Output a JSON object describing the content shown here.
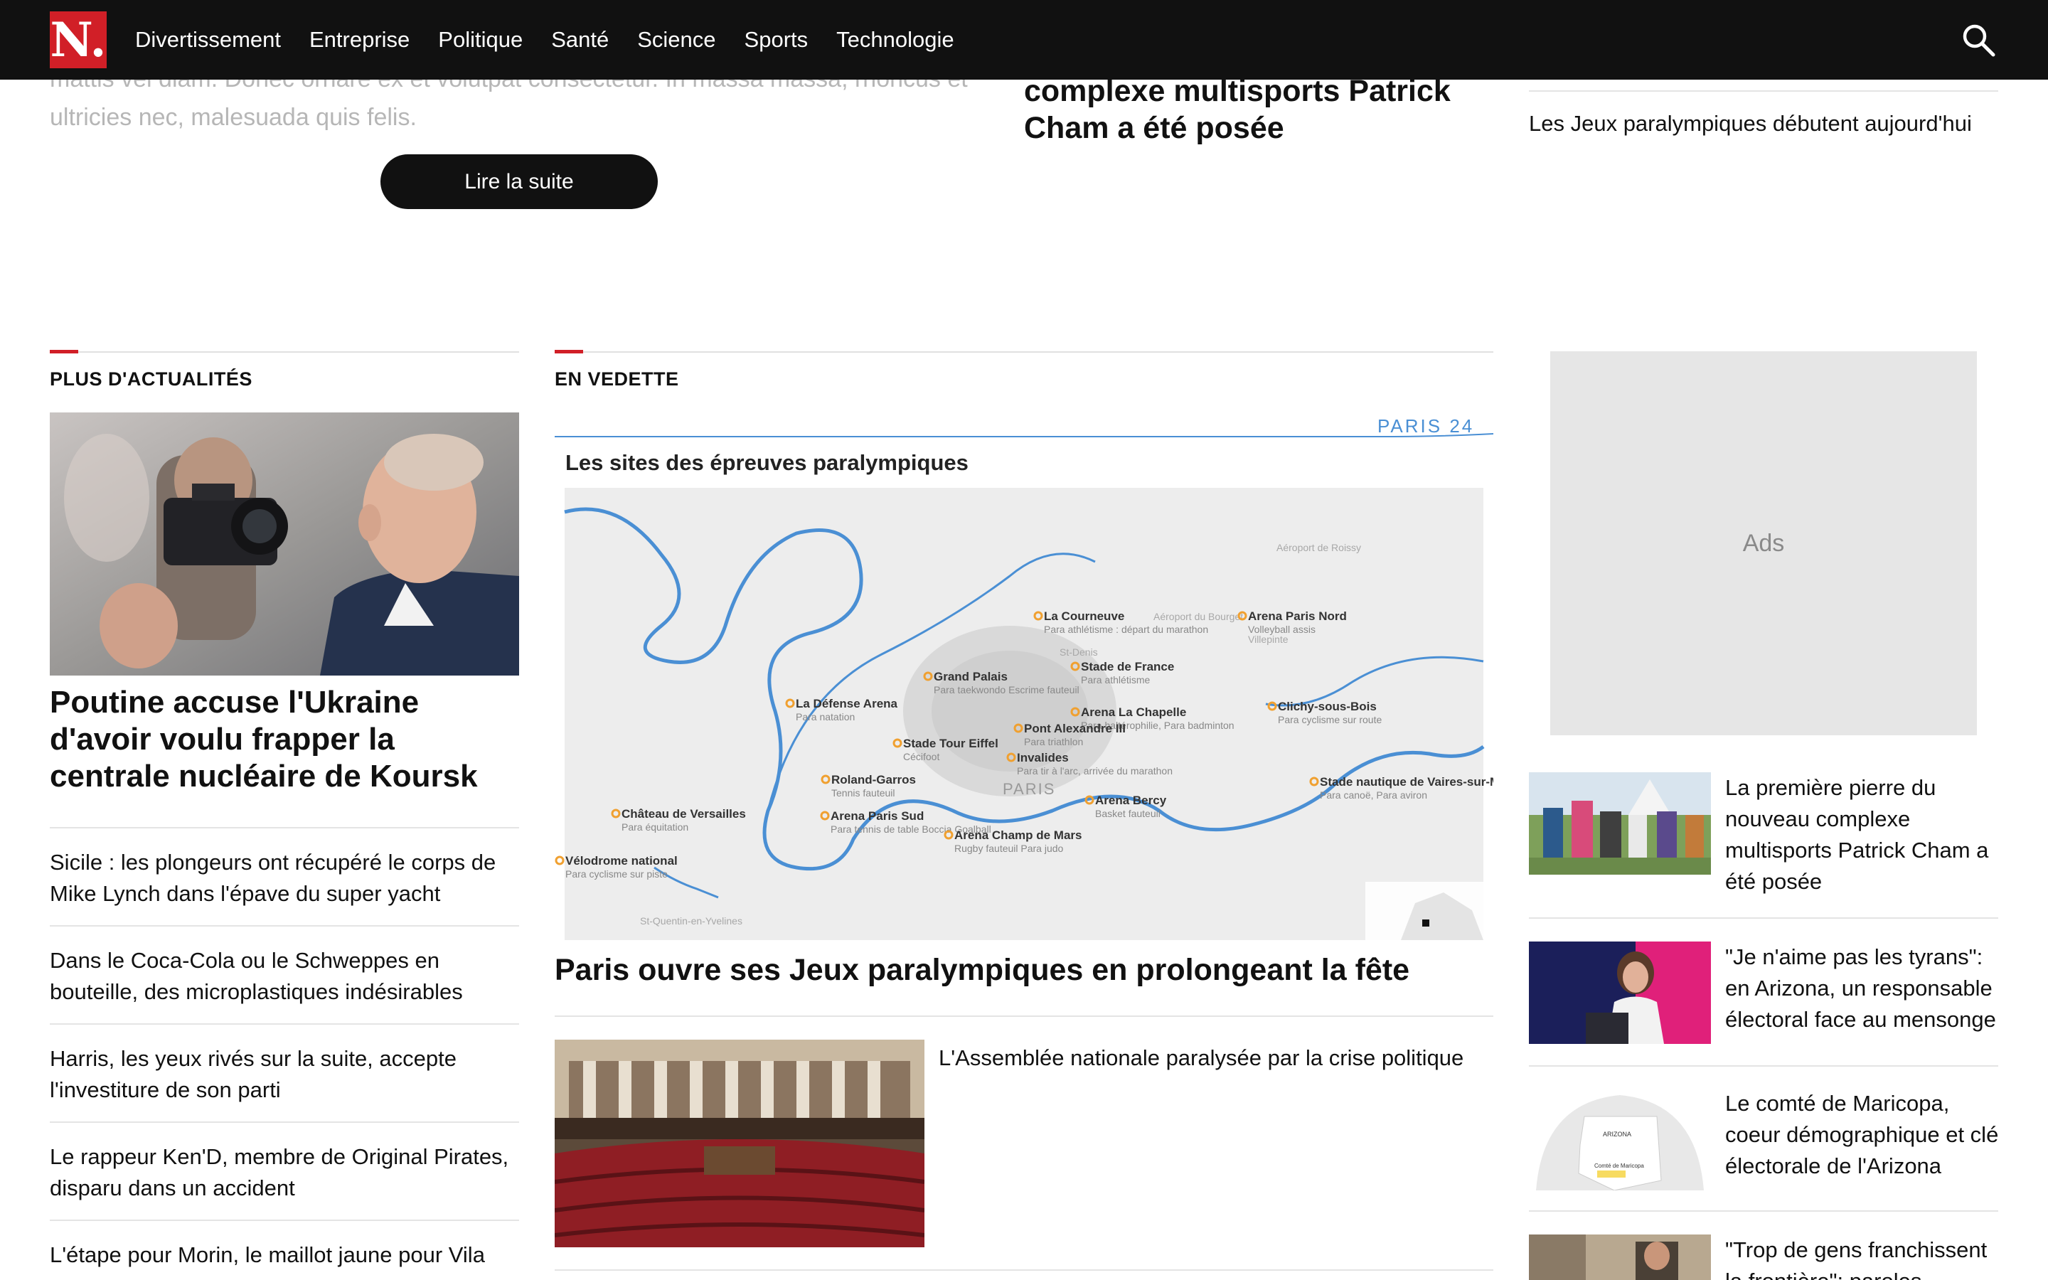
{
  "nav": {
    "logo": "N.",
    "items": [
      "Divertissement",
      "Entreprise",
      "Politique",
      "Santé",
      "Science",
      "Sports",
      "Technologie"
    ],
    "search_icon": "search-icon"
  },
  "top": {
    "faded_text": "mattis vel diam. Donec ornare ex et volutpat consectetur. In massa massa, rhoncus et ultricies nec, malesuada quis felis.",
    "read_more": "Lire la suite",
    "mid_title": "complexe multisports Patrick Cham a été posée",
    "right_link": "Les Jeux paralympiques débutent aujourd'hui"
  },
  "sections": {
    "more_news": "PLUS D'ACTUALITÉS",
    "featured": "EN VEDETTE"
  },
  "left": {
    "headline": "Poutine accuse l'Ukraine d'avoir voulu frapper la centrale nucléaire de Koursk",
    "items": [
      "Sicile : les plongeurs ont récupéré le corps de Mike Lynch dans l'épave du super yacht",
      "Dans le Coca-Cola ou le Schweppes en bouteille, des microplastiques indésirables",
      "Harris, les yeux rivés sur la suite, accepte l'investiture de son parti",
      "Le rappeur Ken'D, membre de Original Pirates, disparu dans un accident",
      "L'étape pour Morin, le maillot jaune pour Vila"
    ]
  },
  "map": {
    "brand": "PARIS 24",
    "title": "Les sites des épreuves paralympiques",
    "paris_label": "PARIS",
    "places": [
      {
        "name": "Aéroport de Roissy",
        "sub": ""
      },
      {
        "name": "La Courneuve",
        "sub": "Para athlétisme : départ du marathon"
      },
      {
        "name": "Aéroport du Bourget",
        "sub": ""
      },
      {
        "name": "Arena Paris Nord",
        "sub": "Volleyball assis"
      },
      {
        "name": "Villepinte",
        "sub": ""
      },
      {
        "name": "St-Denis",
        "sub": ""
      },
      {
        "name": "Stade de France",
        "sub": "Para athlétisme"
      },
      {
        "name": "Grand Palais",
        "sub": "Para taekwondo Escrime fauteuil"
      },
      {
        "name": "Clichy-sous-Bois",
        "sub": "Para cyclisme sur route"
      },
      {
        "name": "La Défense Arena",
        "sub": "Para natation"
      },
      {
        "name": "Arena La Chapelle",
        "sub": "Para haltérophilie, Para badminton"
      },
      {
        "name": "Pont Alexandre III",
        "sub": "Para triathlon"
      },
      {
        "name": "Stade Tour Eiffel",
        "sub": "Cécifoot"
      },
      {
        "name": "Invalides",
        "sub": "Para tir à l'arc, arrivée du marathon"
      },
      {
        "name": "Roland-Garros",
        "sub": "Tennis fauteuil"
      },
      {
        "name": "Arena Bercy",
        "sub": "Basket fauteuil"
      },
      {
        "name": "Stade nautique de Vaires-sur-Marne",
        "sub": "Para canoë, Para aviron"
      },
      {
        "name": "Château de Versailles",
        "sub": "Para équitation"
      },
      {
        "name": "Arena Paris Sud",
        "sub": "Para tennis de table Boccia Goalball"
      },
      {
        "name": "Arena Champ de Mars",
        "sub": "Rugby fauteuil Para judo"
      },
      {
        "name": "Vélodrome national",
        "sub": "Para cyclisme sur piste"
      },
      {
        "name": "St-Quentin-en-Yvelines",
        "sub": ""
      }
    ]
  },
  "middle": {
    "headline": "Paris ouvre ses Jeux paralympiques en prolongeant la fête",
    "secondary": "L'Assemblée nationale paralysée par la crise politique"
  },
  "right": {
    "ads": "Ads",
    "items": [
      "La première pierre du nouveau complexe multisports Patrick Cham a été posée",
      "\"Je n'aime pas les tyrans\": en Arizona, un responsable électoral face au mensonge",
      "Le comté de Maricopa, coeur démographique et clé électorale de l'Arizona",
      "\"Trop de gens franchissent la frontière\": paroles"
    ],
    "thumb3_labels": [
      "ARIZONA",
      "Comté de Maricopa"
    ]
  },
  "colors": {
    "brand_red": "#d11f27",
    "nav_bg": "#111111",
    "map_river": "#4a8fd4",
    "map_accent": "#f0a030"
  }
}
